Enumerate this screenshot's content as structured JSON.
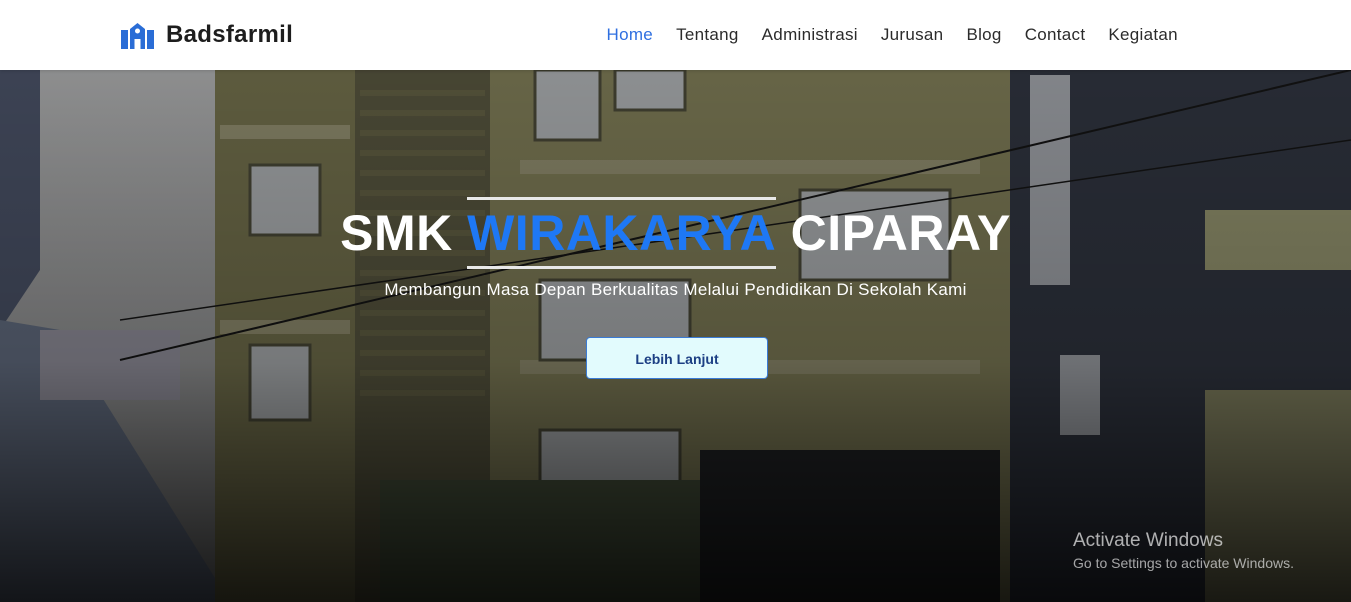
{
  "navbar": {
    "brand": "Badsfarmil",
    "brand_icon": "school-building-icon",
    "brand_color": "#2a6dd6",
    "items": [
      {
        "label": "Home",
        "active": true
      },
      {
        "label": "Tentang",
        "active": false
      },
      {
        "label": "Administrasi",
        "active": false
      },
      {
        "label": "Jurusan",
        "active": false
      },
      {
        "label": "Blog",
        "active": false
      },
      {
        "label": "Contact",
        "active": false
      },
      {
        "label": "Kegiatan",
        "active": false
      }
    ]
  },
  "hero": {
    "title_prefix": "SMK ",
    "title_accent": "WIRAKARYA",
    "title_suffix": " CIPARAY",
    "subtitle": "Membangun Masa Depan Berkualitas Melalui Pendidikan Di Sekolah Kami",
    "cta_label": "Lebih Lanjut",
    "accent_color": "#1e78f5"
  },
  "watermark": {
    "title": "Activate Windows",
    "subtitle": "Go to Settings to activate Windows."
  }
}
